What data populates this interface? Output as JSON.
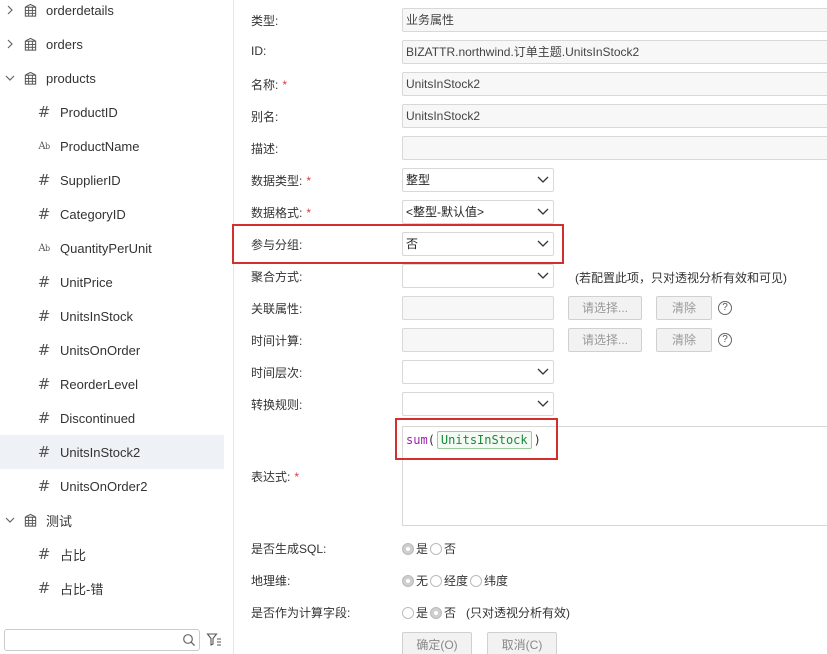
{
  "tree": {
    "tables": [
      {
        "label": "orderdetails",
        "expanded": false
      },
      {
        "label": "orders",
        "expanded": false
      },
      {
        "label": "products",
        "expanded": true
      }
    ],
    "fields": [
      {
        "label": "ProductID",
        "type": "number"
      },
      {
        "label": "ProductName",
        "type": "text"
      },
      {
        "label": "SupplierID",
        "type": "number"
      },
      {
        "label": "CategoryID",
        "type": "number"
      },
      {
        "label": "QuantityPerUnit",
        "type": "text"
      },
      {
        "label": "UnitPrice",
        "type": "number"
      },
      {
        "label": "UnitsInStock",
        "type": "number"
      },
      {
        "label": "UnitsOnOrder",
        "type": "number"
      },
      {
        "label": "ReorderLevel",
        "type": "number"
      },
      {
        "label": "Discontinued",
        "type": "number"
      },
      {
        "label": "UnitsInStock2",
        "type": "number",
        "selected": true
      },
      {
        "label": "UnitsOnOrder2",
        "type": "number"
      }
    ],
    "folder": {
      "label": "测试",
      "expanded": true
    },
    "folder_fields": [
      {
        "label": "占比",
        "type": "number"
      },
      {
        "label": "占比-错",
        "type": "number"
      }
    ],
    "search_placeholder": ""
  },
  "form": {
    "type_label": "类型:",
    "type_value": "业务属性",
    "id_label": "ID:",
    "id_value": "BIZATTR.northwind.订单主题.UnitsInStock2",
    "name_label": "名称:",
    "name_value": "UnitsInStock2",
    "alias_label": "别名:",
    "alias_value": "UnitsInStock2",
    "desc_label": "描述:",
    "desc_value": "",
    "datatype_label": "数据类型:",
    "datatype_value": "整型",
    "format_label": "数据格式:",
    "format_value": "<整型-默认值>",
    "group_label": "参与分组:",
    "group_value": "否",
    "agg_label": "聚合方式:",
    "agg_value": "",
    "agg_hint": "(若配置此项，只对透视分析有效和可见)",
    "related_label": "关联属性:",
    "time_calc_label": "时间计算:",
    "select_btn": "请选择...",
    "clear_btn": "清除",
    "help_glyph": "?",
    "time_level_label": "时间层次:",
    "convert_label": "转换规则:",
    "expr_label": "表达式:",
    "expr": {
      "fn": "sum",
      "open": "(",
      "token": "UnitsInStock",
      "close": ")"
    },
    "gen_sql_label": "是否生成SQL:",
    "gen_sql_options": [
      "是",
      "否"
    ],
    "geo_label": "地理维:",
    "geo_options": [
      "无",
      "经度",
      "纬度"
    ],
    "calc_field_label": "是否作为计算字段:",
    "calc_field_options": [
      "是",
      "否"
    ],
    "calc_field_note": "(只对透视分析有效)",
    "required_mark": "*",
    "ok_btn": "确定(O)",
    "cancel_btn": "取消(C)"
  },
  "colors": {
    "highlight_box": "#d32f2f",
    "required": "#e4393c",
    "function": "#a020b0",
    "token": "#1a8a3a",
    "selected_row": "#eef1f6"
  }
}
